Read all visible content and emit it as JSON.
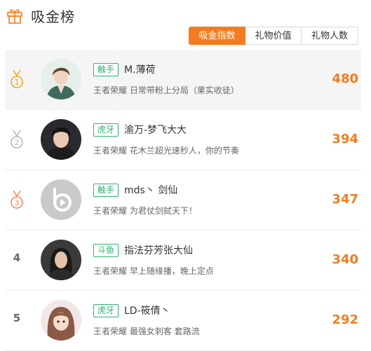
{
  "header": {
    "title": "吸金榜",
    "icon": "gift-icon"
  },
  "tabs": [
    {
      "label": "吸金指数",
      "active": true
    },
    {
      "label": "礼物价值",
      "active": false
    },
    {
      "label": "礼物人数",
      "active": false
    }
  ],
  "colors": {
    "accent": "#f47c20",
    "platform_green": "#2fb36b",
    "gold": "#f5a623",
    "silver": "#b8b8b8",
    "bronze": "#f28a5c"
  },
  "rows": [
    {
      "rank": "1",
      "medal": "gold-medal-icon",
      "platform": "触手",
      "name": "M.薄荷",
      "desc": "王者荣耀 日常带粉上分局（果实收徒）",
      "score": "480"
    },
    {
      "rank": "2",
      "medal": "silver-medal-icon",
      "platform": "虎牙",
      "name": "渝万-梦飞大大",
      "desc": "王者荣耀 花木兰超光速秒人，你的节奏",
      "score": "394"
    },
    {
      "rank": "3",
      "medal": "bronze-medal-icon",
      "platform": "触手",
      "name": "mds丶 剑仙",
      "desc": "王者荣耀 为君仗剑弑天下！",
      "score": "347"
    },
    {
      "rank": "4",
      "platform": "斗鱼",
      "name": "指法芬芳张大仙",
      "desc": "王者荣耀 早上随缘播，晚上定点",
      "score": "340"
    },
    {
      "rank": "5",
      "platform": "虎牙",
      "name": "LD-筱倩丶",
      "desc": "王者荣耀 最强女刺客 套路流",
      "score": "292"
    }
  ]
}
